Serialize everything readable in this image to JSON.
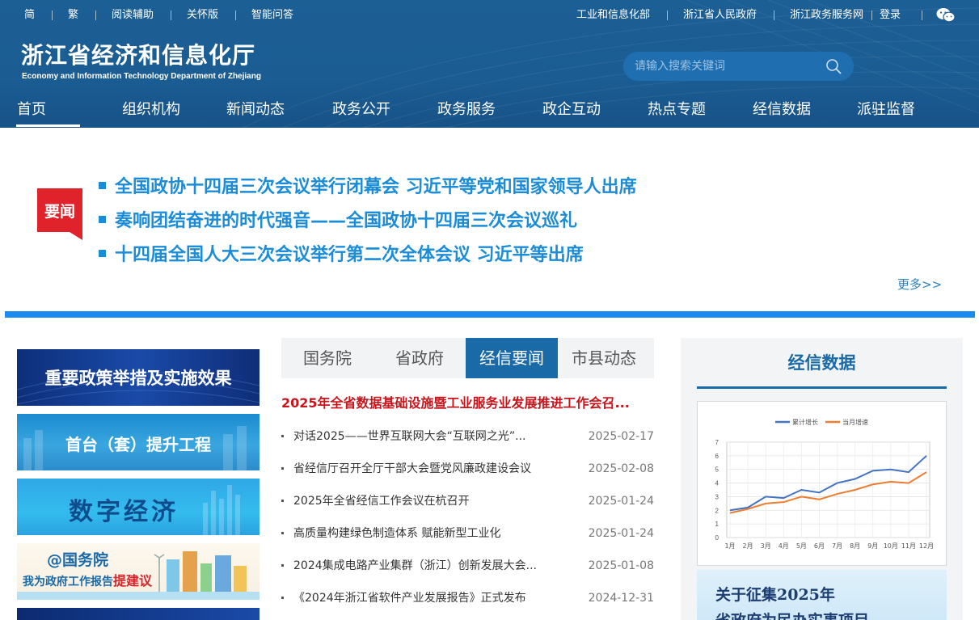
{
  "topbar": {
    "left_links": [
      "简",
      "繁",
      "阅读辅助",
      "关怀版",
      "智能问答"
    ],
    "right_links": [
      "工业和信息化部",
      "浙江省人民政府",
      "浙江政务服务网",
      "登录"
    ]
  },
  "logo": {
    "cn": "浙江省经济和信息化厅",
    "en": "Economy and Information Technology Department of Zhejiang"
  },
  "search": {
    "placeholder": "请输入搜索关键词"
  },
  "nav": {
    "items": [
      "首页",
      "组织机构",
      "新闻动态",
      "政务公开",
      "政务服务",
      "政企互动",
      "热点专题",
      "经信数据",
      "派驻监督"
    ],
    "active": "首页"
  },
  "headlines": {
    "badge": "要闻",
    "items": [
      "全国政协十四届三次会议举行闭幕会 习近平等党和国家领导人出席",
      "奏响团结奋进的时代强音——全国政协十四届三次会议巡礼",
      "十四届全国人大三次会议举行第二次全体会议 习近平等出席"
    ],
    "more": "更多>>"
  },
  "banners": [
    "重要政策举措及实施效果",
    "首台（套）提升工程",
    "数字经济",
    "@国务院",
    "我为政府工作报告",
    "提建议"
  ],
  "news": {
    "tabs": [
      "国务院",
      "省政府",
      "经信要闻",
      "市县动态"
    ],
    "active_tab": "经信要闻",
    "feature": "2025年全省数据基础设施暨工业服务业发展推进工作会召...",
    "items": [
      {
        "title": "对话2025——世界互联网大会“互联网之光”...",
        "date": "2025-02-17"
      },
      {
        "title": "省经信厅召开全厅干部大会暨党风廉政建设会议",
        "date": "2025-02-08"
      },
      {
        "title": "2025年全省经信工作会议在杭召开",
        "date": "2025-01-24"
      },
      {
        "title": "高质量构建绿色制造体系 赋能新型工业化",
        "date": "2025-01-24"
      },
      {
        "title": "2024集成电路产业集群（浙江）创新发展大会...",
        "date": "2025-01-08"
      },
      {
        "title": "《2024年浙江省软件产业发展报告》正式发布",
        "date": "2024-12-31"
      }
    ]
  },
  "data_panel": {
    "title": "经信数据",
    "notice_line1": "关于征集2025年",
    "notice_line2": "省政府为民办实事项目"
  },
  "chart_data": {
    "type": "line",
    "categories": [
      "1月",
      "2月",
      "3月",
      "4月",
      "5月",
      "6月",
      "7月",
      "8月",
      "9月",
      "10月",
      "11月",
      "12月"
    ],
    "series": [
      {
        "name": "累计增长",
        "color": "#4472c4",
        "values": [
          2.0,
          2.2,
          3.0,
          2.9,
          3.5,
          3.3,
          4.0,
          4.3,
          4.9,
          5.0,
          4.8,
          6.0
        ]
      },
      {
        "name": "当月增速",
        "color": "#ed7d31",
        "values": [
          1.8,
          2.1,
          2.5,
          2.6,
          3.0,
          2.8,
          3.2,
          3.5,
          3.9,
          4.1,
          4.0,
          4.8
        ]
      }
    ],
    "ylim": [
      0,
      7
    ],
    "yticks": [
      0,
      1,
      2,
      3,
      4,
      5,
      6,
      7
    ],
    "grid": true,
    "legend": "top"
  }
}
